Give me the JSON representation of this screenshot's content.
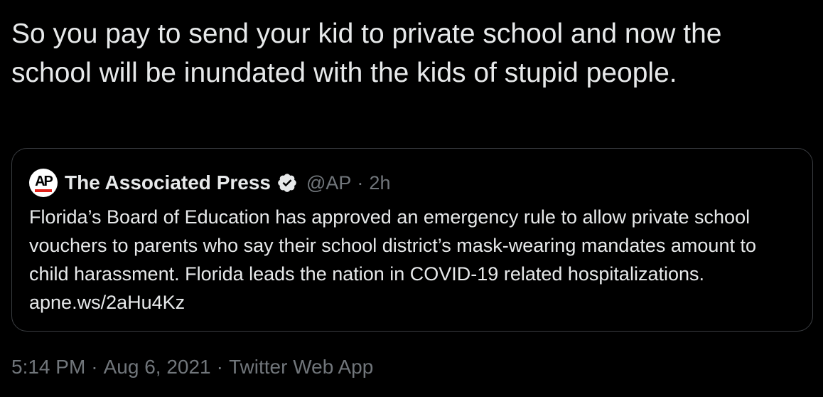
{
  "tweet": {
    "text": "So you pay to send your kid to private school and now the school will be inundated with the kids of stupid people.",
    "timestamp_time": "5:14 PM",
    "timestamp_date": "Aug 6, 2021",
    "source": "Twitter Web App",
    "separator": "·"
  },
  "quote": {
    "avatar_text": "AP",
    "avatar_icon": "ap-logo-icon",
    "author_name": "The Associated Press",
    "verified_icon": "verified-badge-icon",
    "handle": "@AP",
    "separator": "·",
    "time_ago": "2h",
    "body_text": "Florida’s Board of Education has approved an emergency rule to allow private school vouchers to parents who say their school district’s mask-wearing mandates amount to child harassment. Florida leads the nation in COVID-19 related hospitalizations.",
    "link_text": "apne.ws/2aHu4Kz"
  },
  "colors": {
    "background": "#000000",
    "primary_text": "#e7e9ea",
    "secondary_text": "#71767b",
    "border": "#3a3d41",
    "ap_red": "#e0221b"
  }
}
